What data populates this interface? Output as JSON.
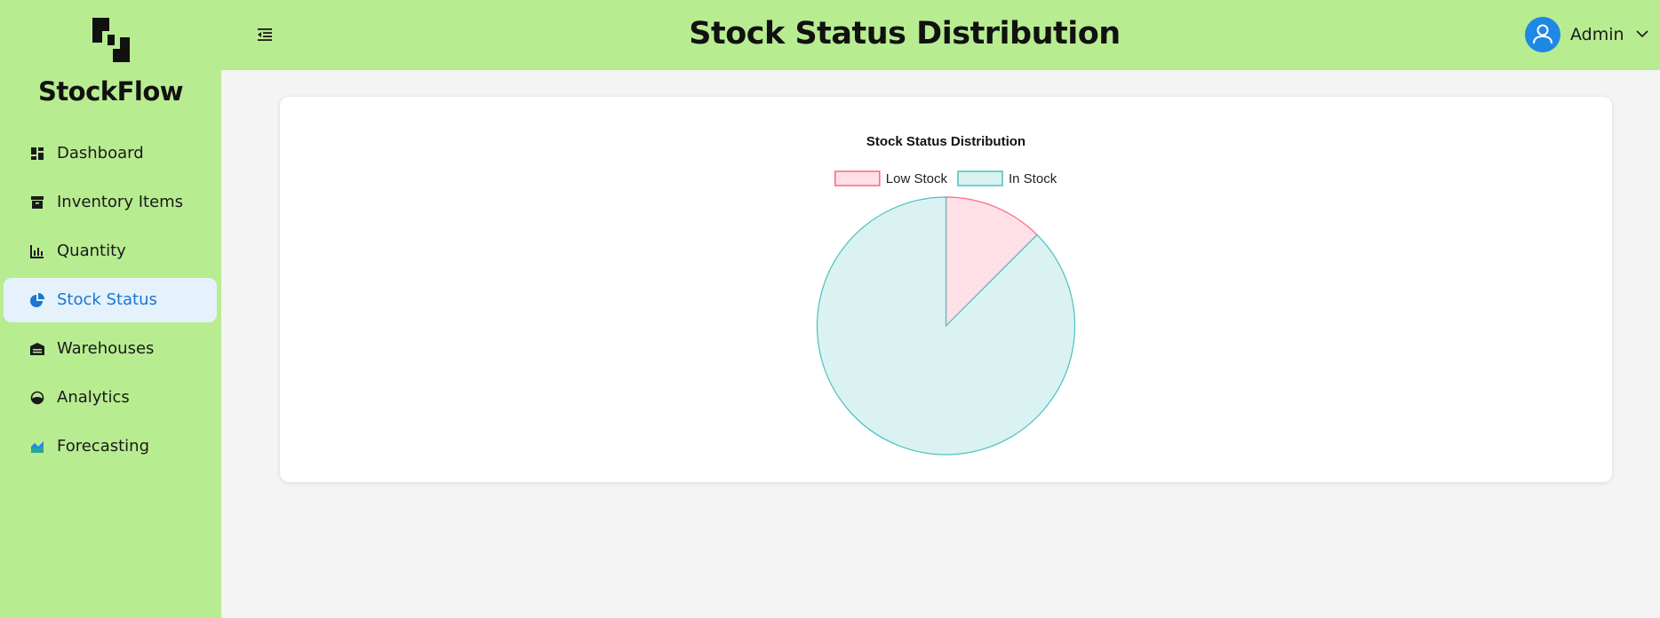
{
  "app": {
    "brand": "StockFlow"
  },
  "header": {
    "title": "Stock Status Distribution",
    "user_name": "Admin"
  },
  "sidebar": {
    "items": [
      {
        "label": "Dashboard",
        "icon": "dashboard-icon",
        "active": false
      },
      {
        "label": "Inventory Items",
        "icon": "archive-icon",
        "active": false
      },
      {
        "label": "Quantity",
        "icon": "bar-chart-icon",
        "active": false
      },
      {
        "label": "Stock Status",
        "icon": "pie-chart-icon",
        "active": true
      },
      {
        "label": "Warehouses",
        "icon": "warehouse-icon",
        "active": false
      },
      {
        "label": "Analytics",
        "icon": "gauge-icon",
        "active": false
      },
      {
        "label": "Forecasting",
        "icon": "area-chart-icon",
        "active": false
      }
    ]
  },
  "colors": {
    "sidebar_bg": "#b8ec91",
    "active_bg": "#e5f2fc",
    "active_text": "#1976d2",
    "avatar_bg": "#1e88e5"
  },
  "chart_data": {
    "type": "pie",
    "title": "Stock Status Distribution",
    "legend_position": "top",
    "series": [
      {
        "name": "Low Stock",
        "value": 12.5,
        "fill": "#ffe0e6",
        "stroke": "#ff6384"
      },
      {
        "name": "In Stock",
        "value": 87.5,
        "fill": "#dbf2f2",
        "stroke": "#4bc0c0"
      }
    ]
  }
}
